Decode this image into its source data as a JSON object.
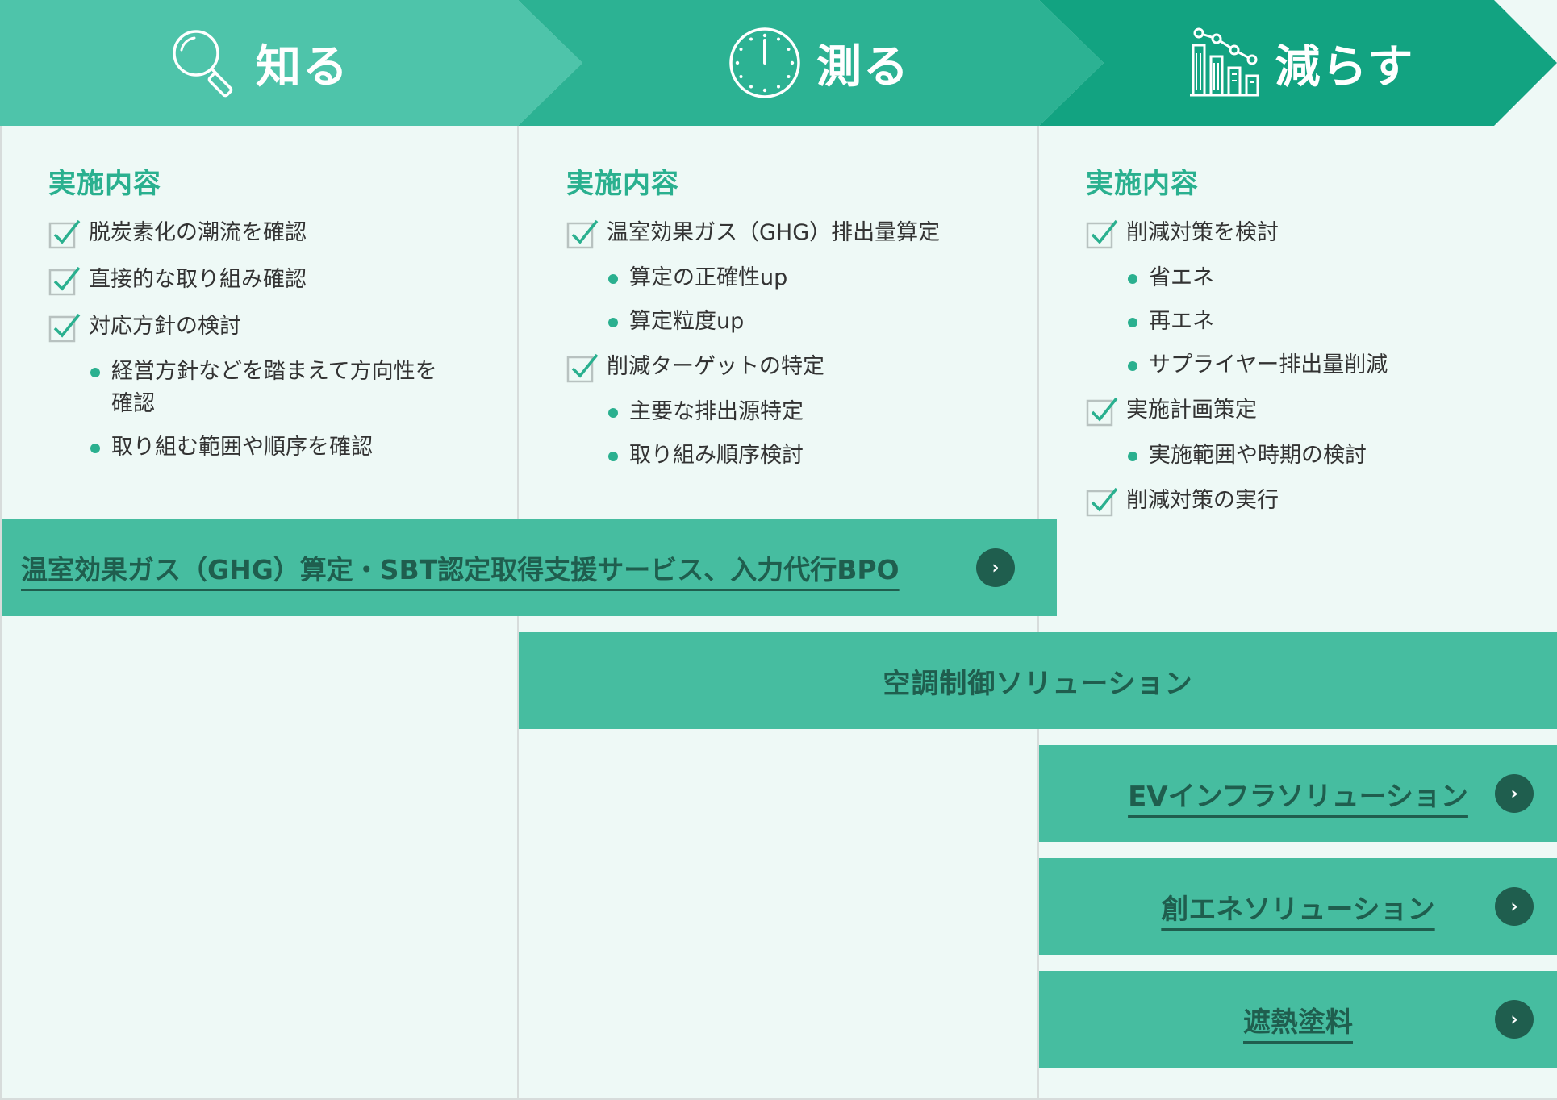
{
  "colors": {
    "stage1": "#4ec4aa",
    "stage2": "#2cb293",
    "stage3": "#12a381",
    "accent": "#2ab08f",
    "banner": "#46bda0",
    "banner_text": "#1f5e4e",
    "background": "#eef9f6"
  },
  "stages": [
    {
      "title": "知る",
      "icon": "magnifier-icon"
    },
    {
      "title": "測る",
      "icon": "clock-icon"
    },
    {
      "title": "減らす",
      "icon": "bar-chart-down-icon"
    }
  ],
  "columns": [
    {
      "heading": "実施内容",
      "items": [
        {
          "label": "脱炭素化の潮流を確認",
          "subs": []
        },
        {
          "label": "直接的な取り組み確認",
          "subs": []
        },
        {
          "label": "対応方針の検討",
          "subs": [
            "経営方針などを踏まえて方向性を確認",
            "取り組む範囲や順序を確認"
          ]
        }
      ]
    },
    {
      "heading": "実施内容",
      "items": [
        {
          "label": "温室効果ガス（GHG）排出量算定",
          "subs": [
            "算定の正確性up",
            "算定粒度up"
          ]
        },
        {
          "label": "削減ターゲットの特定",
          "subs": [
            "主要な排出源特定",
            "取り組み順序検討"
          ]
        }
      ]
    },
    {
      "heading": "実施内容",
      "items": [
        {
          "label": "削減対策を検討",
          "subs": [
            "省エネ",
            "再エネ",
            "サプライヤー排出量削減"
          ]
        },
        {
          "label": "実施計画策定",
          "subs": [
            "実施範囲や時期の検討"
          ]
        },
        {
          "label": "削減対策の実行",
          "subs": []
        }
      ]
    }
  ],
  "banners": {
    "ghg": {
      "label": "温室効果ガス（GHG）算定・SBT認定取得支援サービス、入力代行BPO",
      "arrow": "›"
    },
    "hvac": {
      "label": "空調制御ソリューション"
    },
    "ev": {
      "label": "EVインフラソリューション",
      "arrow": "›"
    },
    "energy": {
      "label": "創エネソリューション",
      "arrow": "›"
    },
    "paint": {
      "label": "遮熱塗料",
      "arrow": "›"
    }
  }
}
